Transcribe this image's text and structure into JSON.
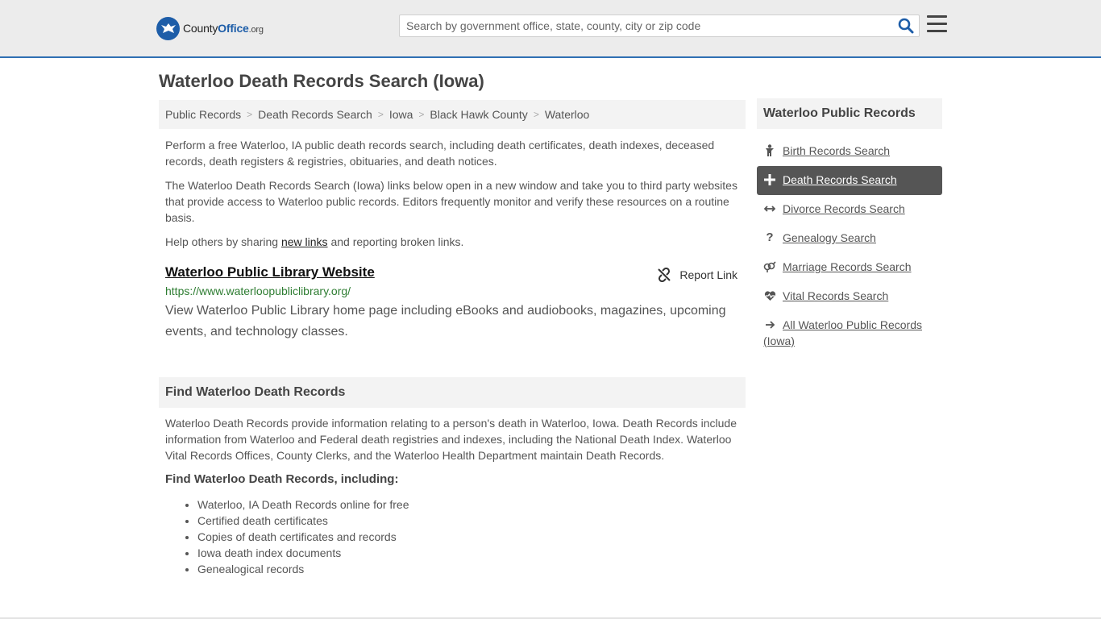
{
  "header": {
    "logo": {
      "brand": "County",
      "office": "Office",
      "tld": ".org"
    },
    "search_placeholder": "Search by government office, state, county, city or zip code",
    "accent_color": "#2f6fb3"
  },
  "page_title": "Waterloo Death Records Search (Iowa)",
  "breadcrumb": [
    "Public Records",
    "Death Records Search",
    "Iowa",
    "Black Hawk County",
    "Waterloo"
  ],
  "intro": {
    "p1": "Perform a free Waterloo, IA public death records search, including death certificates, death indexes, deceased records, death registers & registries, obituaries, and death notices.",
    "p2": "The Waterloo Death Records Search (Iowa) links below open in a new window and take you to third party websites that provide access to Waterloo public records. Editors frequently monitor and verify these resources on a routine basis.",
    "p3_before": "Help others by sharing ",
    "p3_link": "new links",
    "p3_after": " and reporting broken links."
  },
  "listing": {
    "title": "Waterloo Public Library Website",
    "report_label": "Report Link",
    "url": "https://www.waterloopubliclibrary.org/",
    "description": "View Waterloo Public Library home page including eBooks and audiobooks, magazines, upcoming events, and technology classes."
  },
  "find_section": {
    "heading": "Find Waterloo Death Records",
    "body": "Waterloo Death Records provide information relating to a person's death in Waterloo, Iowa. Death Records include information from Waterloo and Federal death registries and indexes, including the National Death Index. Waterloo Vital Records Offices, County Clerks, and the Waterloo Health Department maintain Death Records.",
    "subheading": "Find Waterloo Death Records, including:",
    "items": [
      "Waterloo, IA Death Records online for free",
      "Certified death certificates",
      "Copies of death certificates and records",
      "Iowa death index documents",
      "Genealogical records"
    ]
  },
  "sidebar": {
    "heading": "Waterloo Public Records",
    "items": [
      {
        "label": "Birth Records Search",
        "icon": "baby-icon"
      },
      {
        "label": "Death Records Search",
        "icon": "cross-icon"
      },
      {
        "label": "Divorce Records Search",
        "icon": "arrows-icon"
      },
      {
        "label": "Genealogy Search",
        "icon": "question-icon"
      },
      {
        "label": "Marriage Records Search",
        "icon": "gender-icon"
      },
      {
        "label": "Vital Records Search",
        "icon": "heartbeat-icon"
      },
      {
        "label": "All Waterloo Public Records (Iowa)",
        "icon": "arrow-right-icon"
      }
    ]
  }
}
